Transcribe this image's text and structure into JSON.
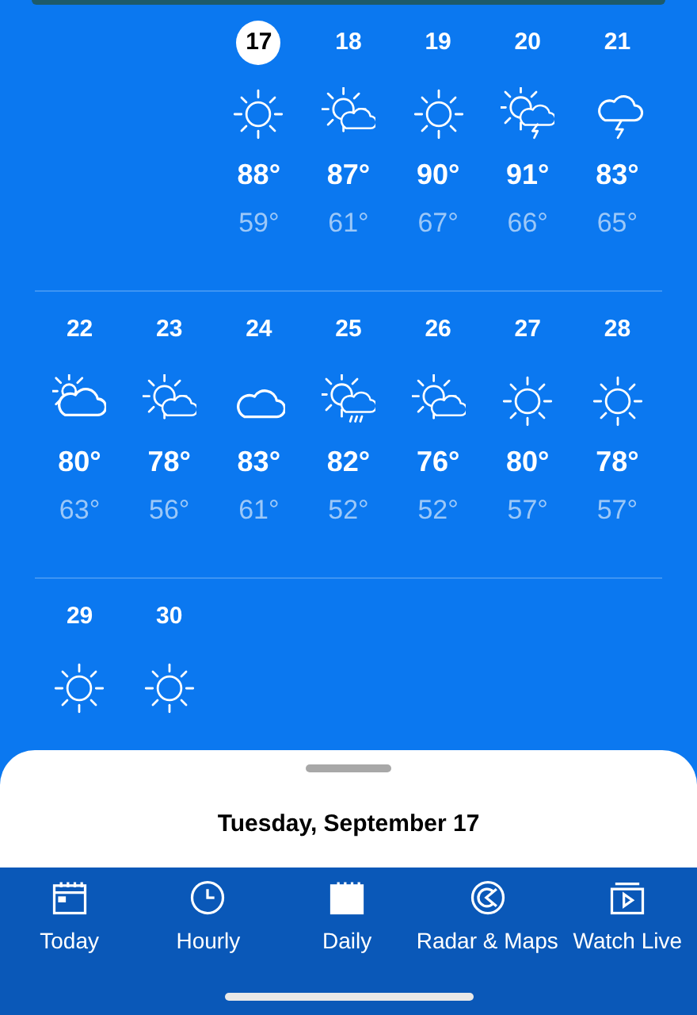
{
  "weeks": [
    {
      "days": [
        {
          "day": "17",
          "selected": true,
          "kind": "sunny",
          "high": "88°",
          "low": "59°"
        },
        {
          "day": "18",
          "selected": false,
          "kind": "partly_cloudy",
          "high": "87°",
          "low": "61°"
        },
        {
          "day": "19",
          "selected": false,
          "kind": "sunny",
          "high": "90°",
          "low": "67°"
        },
        {
          "day": "20",
          "selected": false,
          "kind": "partly_thunder",
          "high": "91°",
          "low": "66°"
        },
        {
          "day": "21",
          "selected": false,
          "kind": "thunder",
          "high": "83°",
          "low": "65°"
        }
      ]
    },
    {
      "days": [
        {
          "day": "22",
          "selected": false,
          "kind": "mostly_cloudy",
          "high": "80°",
          "low": "63°"
        },
        {
          "day": "23",
          "selected": false,
          "kind": "partly_cloudy",
          "high": "78°",
          "low": "56°"
        },
        {
          "day": "24",
          "selected": false,
          "kind": "cloudy",
          "high": "83°",
          "low": "61°"
        },
        {
          "day": "25",
          "selected": false,
          "kind": "partly_rain",
          "high": "82°",
          "low": "52°"
        },
        {
          "day": "26",
          "selected": false,
          "kind": "partly_cloudy",
          "high": "76°",
          "low": "52°"
        },
        {
          "day": "27",
          "selected": false,
          "kind": "sunny",
          "high": "80°",
          "low": "57°"
        },
        {
          "day": "28",
          "selected": false,
          "kind": "sunny",
          "high": "78°",
          "low": "57°"
        }
      ]
    },
    {
      "days": [
        {
          "day": "29",
          "selected": false,
          "kind": "sunny"
        },
        {
          "day": "30",
          "selected": false,
          "kind": "sunny"
        }
      ]
    }
  ],
  "sheet": {
    "title": "Tuesday, September 17"
  },
  "tabs": [
    {
      "label": "Today",
      "kind": "today",
      "selected": false
    },
    {
      "label": "Hourly",
      "kind": "hourly",
      "selected": false
    },
    {
      "label": "Daily",
      "kind": "daily",
      "selected": true
    },
    {
      "label": "Radar & Maps",
      "kind": "radar",
      "selected": false
    },
    {
      "label": "Watch Live",
      "kind": "live",
      "selected": false
    }
  ]
}
